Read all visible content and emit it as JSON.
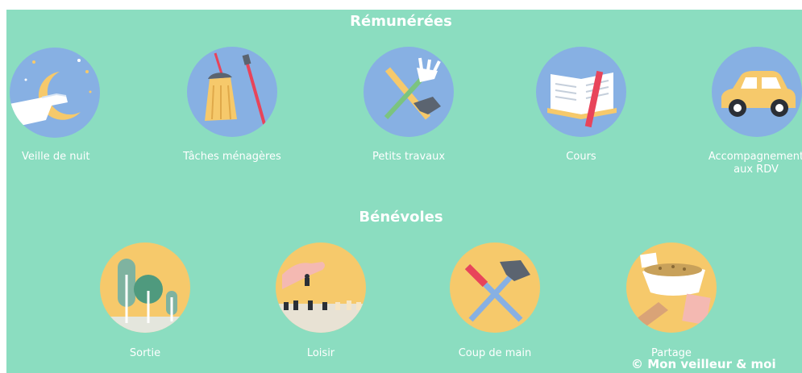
{
  "sections": {
    "paid": {
      "title": "Rémunérées"
    },
    "volunteer": {
      "title": "Bénévoles"
    }
  },
  "paid_items": [
    {
      "label": "Veille de nuit",
      "icon": "moon-icon"
    },
    {
      "label": "Tâches ménagères",
      "icon": "broom-icon"
    },
    {
      "label": "Petits travaux",
      "icon": "tools-icon"
    },
    {
      "label": "Cours",
      "icon": "book-icon"
    },
    {
      "label_line1": "Accompagnement",
      "label_line2": "aux RDV",
      "icon": "car-icon"
    }
  ],
  "volunteer_items": [
    {
      "label": "Sortie",
      "icon": "trees-icon"
    },
    {
      "label": "Loisir",
      "icon": "chess-icon"
    },
    {
      "label": "Coup de main",
      "icon": "hammer-screwdriver-icon"
    },
    {
      "label": "Partage",
      "icon": "food-bowl-icon"
    }
  ],
  "copyright": "© Mon veilleur & moi",
  "colors": {
    "background": "#8bddc0",
    "paid_circle": "#87b0e3",
    "volunteer_circle": "#f6c96b",
    "text": "#ffffff"
  }
}
